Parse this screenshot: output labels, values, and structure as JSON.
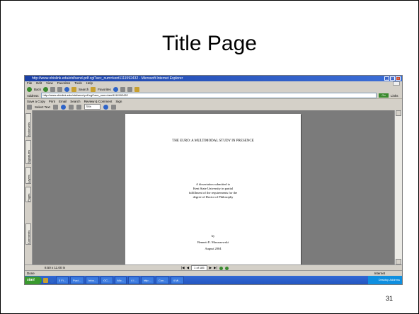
{
  "slide": {
    "title": "Title Page",
    "slide_number": "31"
  },
  "browser": {
    "window_title": "http://www.ohiolink.edu/etd/send-pdf.cgi?acc_num=kent1111592432 - Microsoft Internet Explorer",
    "menu": [
      "File",
      "Edit",
      "View",
      "Favorites",
      "Tools",
      "Help"
    ],
    "toolbar": {
      "back": "Back",
      "search": "Search",
      "favorites": "Favorites"
    },
    "address_label": "Address",
    "address_value": "http://www.ohiolink.edu/etd/send-pdf.cgi?acc_num=kent1111592432",
    "go_label": "Go",
    "links_label": "Links"
  },
  "pdf_toolbar": {
    "save_copy": "Save a Copy",
    "print": "Print",
    "email": "Email",
    "search": "Search",
    "review": "Review & Comment",
    "sign": "Sign",
    "select_text": "Select Text",
    "zoom": "75%"
  },
  "nav_tabs": [
    "Bookmarks",
    "Signatures",
    "Layers",
    "Pages",
    "Comments"
  ],
  "pdf_page": {
    "title": "THE EURO: A MULTIMODAL STUDY IN PRESENCE",
    "block": [
      "A dissertation submitted to",
      "Kent State University in partial",
      "fulfillment of the requirements for the",
      "degree of Doctor of Philosophy"
    ],
    "by": "by",
    "author": "Bennett E. Maruszewski",
    "date": "August 2004"
  },
  "page_controls": {
    "page_size": "8.50 x 11.00 in",
    "page_field": "1 of 185"
  },
  "status": {
    "left": "Done",
    "zone": "Internet"
  },
  "taskbar": {
    "start": "start",
    "tasks": [
      "3 Fi...",
      "Fwd:...",
      "Inbo...",
      "OC...",
      "Mic...",
      "4 I...",
      "http:...",
      "Con...",
      "4 Mi..."
    ],
    "tray": "Desktop  Address"
  }
}
